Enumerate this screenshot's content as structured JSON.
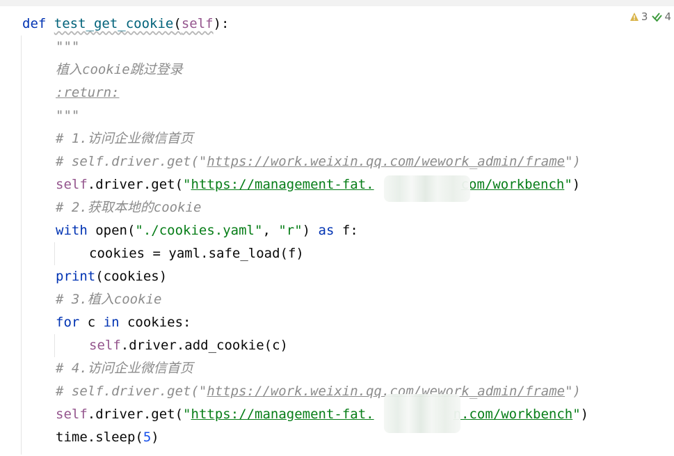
{
  "inspections": {
    "warnings": "3",
    "weak_warnings": "4",
    "warning_color": "#d9b44a",
    "ok_color": "#3e9a3e"
  },
  "code": {
    "l1_def": "def",
    "l1_name": "test_get_cookie",
    "l1_open": "(",
    "l1_self": "self",
    "l1_close": "):",
    "l2": "\"\"\"",
    "l3": "植入cookie跳过登录",
    "l4": ":return:",
    "l5": "\"\"\"",
    "l6": "# 1.访问企业微信首页",
    "l7_pre": "# self.driver.get(\"",
    "l7_url": "https://work.weixin.qq.com/wework_admin/frame",
    "l7_post": "\")",
    "l8_self": "self",
    "l8_mid": ".driver.get(",
    "l8_q1": "\"",
    "l8_url_a": "https://management-fat.",
    "l8_url_b": "com/workbench",
    "l8_q2": "\"",
    "l8_end": ")",
    "l9": "# 2.获取本地的cookie",
    "l10_with": "with",
    "l10_open": " open(",
    "l10_s1": "\"./cookies.yaml\"",
    "l10_comma": ", ",
    "l10_s2": "\"r\"",
    "l10_close": ") ",
    "l10_as": "as",
    "l10_f": " f:",
    "l11": "cookies = yaml.safe_load(f)",
    "l12_print": "print",
    "l12_rest": "(cookies)",
    "l13": "# 3.植入cookie",
    "l14_for": "for",
    "l14_c": " c ",
    "l14_in": "in",
    "l14_rest": " cookies:",
    "l15_self": "self",
    "l15_rest": ".driver.add_cookie(c)",
    "l16": "# 4.访问企业微信首页",
    "l17_pre": "# self.driver.get(\"",
    "l17_url": "https://work.weixin.qq.com/wework_admin/frame",
    "l17_post": "\")",
    "l18_self": "self",
    "l18_mid": ".driver.get(",
    "l18_q1": "\"",
    "l18_url_a": "https://management-fat.",
    "l18_url_b": "n.com/workbench",
    "l18_q2": "\"",
    "l18_end": ")",
    "l19_pre": "time.sleep(",
    "l19_num": "5",
    "l19_post": ")"
  }
}
